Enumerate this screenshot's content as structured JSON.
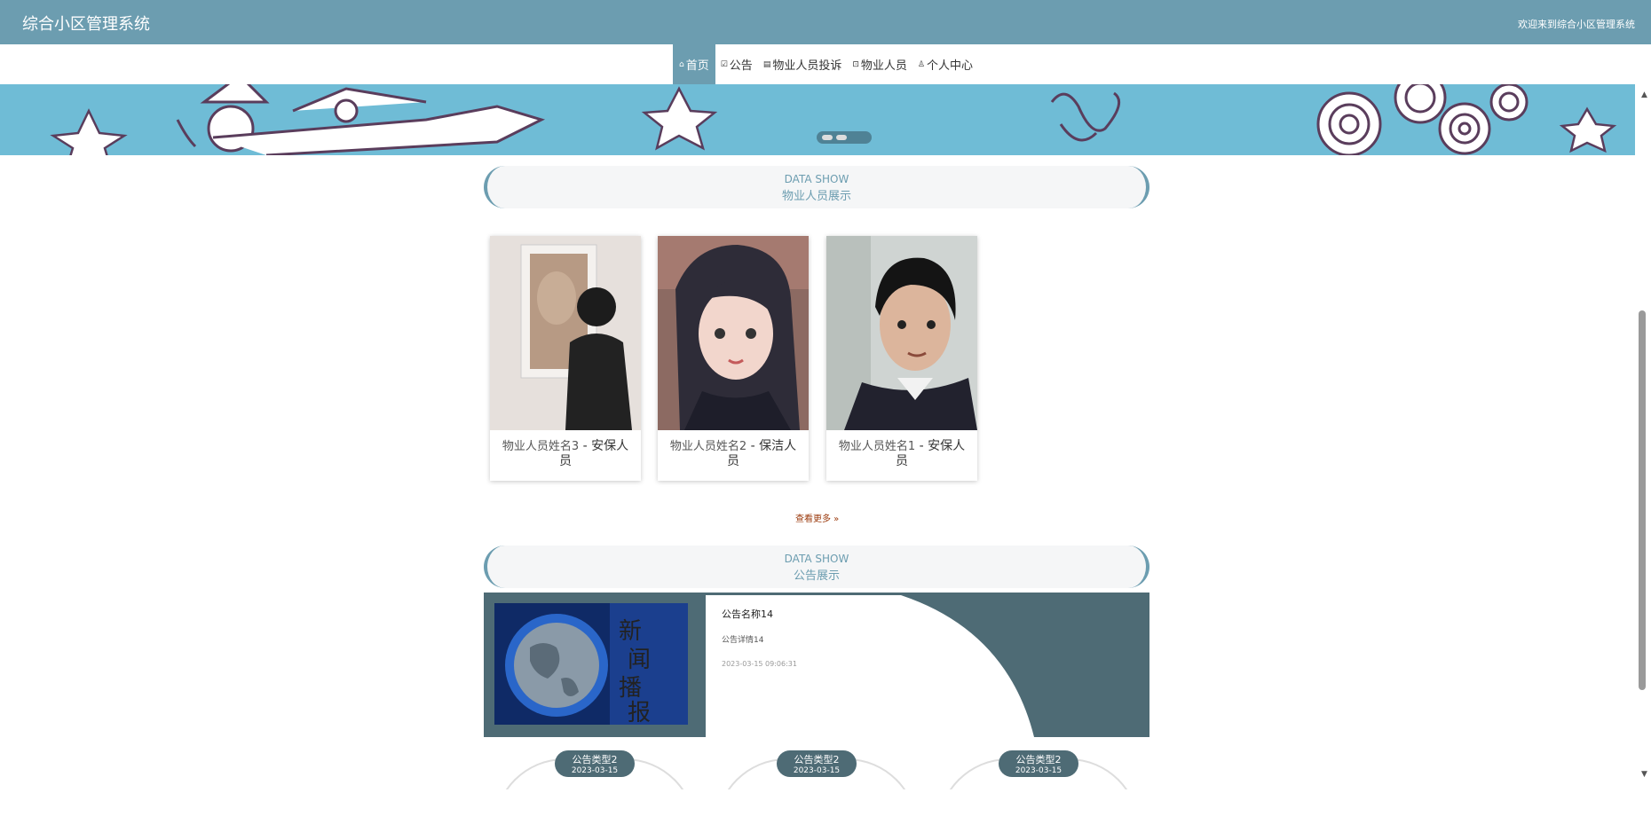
{
  "header": {
    "title": "综合小区管理系统",
    "welcome": "欢迎来到综合小区管理系统"
  },
  "nav": [
    {
      "icon": "⌂",
      "label": "首页",
      "active": true
    },
    {
      "icon": "☑",
      "label": "公告"
    },
    {
      "icon": "▤",
      "label": "物业人员投诉"
    },
    {
      "icon": "⊡",
      "label": "物业人员"
    },
    {
      "icon": "♙",
      "label": "个人中心"
    }
  ],
  "staff_section": {
    "en": "DATA SHOW",
    "cn": "物业人员展示"
  },
  "staff": [
    {
      "name": "物业人员姓名3",
      "role": "- 安保人员"
    },
    {
      "name": "物业人员姓名2",
      "role": "- 保洁人员"
    },
    {
      "name": "物业人员姓名1",
      "role": "- 安保人员"
    }
  ],
  "more_label": "查看更多 »",
  "notice_section": {
    "en": "DATA SHOW",
    "cn": "公告展示"
  },
  "notice": {
    "title": "公告名称14",
    "detail": "公告详情14",
    "time": "2023-03-15 09:06:31"
  },
  "tags": [
    {
      "type": "公告类型2",
      "date": "2023-03-15"
    },
    {
      "type": "公告类型2",
      "date": "2023-03-15"
    },
    {
      "type": "公告类型2",
      "date": "2023-03-15"
    }
  ],
  "colors": {
    "primary": "#6c9db0",
    "dark": "#4e6b75",
    "banner": "#6fbcd6"
  }
}
